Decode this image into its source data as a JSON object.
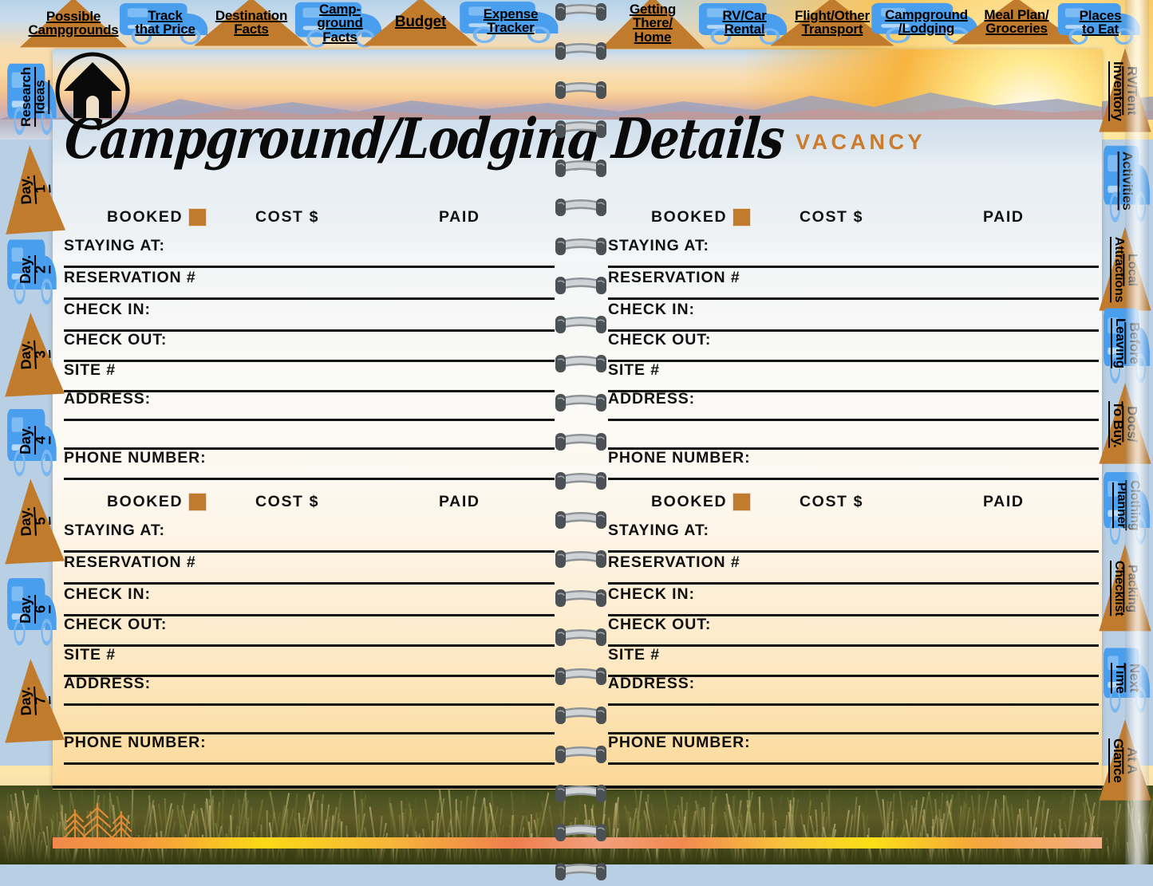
{
  "app": {
    "title": "Campground/Lodging Details",
    "vacancy_label": "VACANCY",
    "home_icon": "home-icon"
  },
  "colors": {
    "tab_orange": "#c07b2d",
    "tab_blue": "#4a9eee",
    "accent_orange": "#cb7b2a",
    "rule_black": "#111111",
    "checkbox_orange": "#c07b2d"
  },
  "top_tabs": [
    {
      "label": "Possible Campgrounds",
      "shape": "tent",
      "lines": [
        "Possible",
        "Campgrounds"
      ]
    },
    {
      "label": "Track that Price",
      "shape": "rv",
      "lines": [
        "Track",
        "that Price"
      ]
    },
    {
      "label": "Destination Facts",
      "shape": "tent",
      "lines": [
        "Destination",
        "Facts"
      ]
    },
    {
      "label": "Campground Facts",
      "shape": "rv",
      "lines": [
        "Camp-",
        "ground",
        "Facts"
      ]
    },
    {
      "label": "Budget",
      "shape": "tent",
      "lines": [
        "Budget"
      ]
    },
    {
      "label": "Expense Tracker",
      "shape": "rv",
      "lines": [
        "Expense",
        "Tracker"
      ]
    },
    {
      "label": "Getting There/ Home",
      "shape": "tent",
      "lines": [
        "Getting",
        "There/",
        "Home"
      ]
    },
    {
      "label": "RV/Car Rental",
      "shape": "rv",
      "lines": [
        "RV/Car",
        "Rental"
      ]
    },
    {
      "label": "Flight/Other Transport",
      "shape": "tent",
      "lines": [
        "Flight/Other",
        "Transport"
      ]
    },
    {
      "label": "Campground /Lodging",
      "shape": "rv",
      "lines": [
        "Campground",
        "/Lodging"
      ]
    },
    {
      "label": "Meal Plan/ Groceries",
      "shape": "tent",
      "lines": [
        "Meal Plan/",
        "Groceries"
      ]
    },
    {
      "label": "Places to Eat",
      "shape": "rv",
      "lines": [
        "Places",
        "to Eat"
      ]
    }
  ],
  "left_tabs": [
    {
      "label": "Research Ideas",
      "shape": "rv",
      "lines": [
        "Research",
        "Ideas"
      ]
    },
    {
      "label": "Day. 1",
      "shape": "tent",
      "lines": [
        "Day.",
        "1"
      ]
    },
    {
      "label": "Day. 2",
      "shape": "rv",
      "lines": [
        "Day.",
        "2"
      ]
    },
    {
      "label": "Day. 3",
      "shape": "tent",
      "lines": [
        "Day.",
        "3"
      ]
    },
    {
      "label": "Day. 4",
      "shape": "rv",
      "lines": [
        "Day.",
        "4"
      ]
    },
    {
      "label": "Day. 5",
      "shape": "tent",
      "lines": [
        "Day.",
        "5"
      ]
    },
    {
      "label": "Day. 6",
      "shape": "rv",
      "lines": [
        "Day.",
        "6"
      ]
    },
    {
      "label": "Day. 7",
      "shape": "tent",
      "lines": [
        "Day.",
        "7"
      ]
    }
  ],
  "right_tabs": [
    {
      "label": "RV/Tent Inventory",
      "shape": "tent",
      "lines": [
        "RV/Tent",
        "Inventory"
      ]
    },
    {
      "label": "Activities",
      "shape": "rv",
      "lines": [
        "Activities"
      ]
    },
    {
      "label": "Local Attractions",
      "shape": "tent",
      "lines": [
        "Local",
        "Attractions"
      ]
    },
    {
      "label": "Before Leaving",
      "shape": "rv",
      "lines": [
        "Before",
        "Leaving"
      ]
    },
    {
      "label": "Docs/ To Buy.",
      "shape": "tent",
      "lines": [
        "Docs/",
        "To Buy."
      ]
    },
    {
      "label": "Clothing Planner",
      "shape": "rv",
      "lines": [
        "Clothing",
        "Planner"
      ]
    },
    {
      "label": "Packing Checklist",
      "shape": "tent",
      "lines": [
        "Packing",
        "Checklist"
      ]
    },
    {
      "label": "Next Time",
      "shape": "rv",
      "lines": [
        "Next",
        "Time"
      ]
    },
    {
      "label": "At A Glance",
      "shape": "tent",
      "lines": [
        "At A",
        "Glance"
      ]
    }
  ],
  "entry_header": {
    "booked": "BOOKED",
    "cost": "COST $",
    "paid": "PAID"
  },
  "entry_fields": [
    "STAYING AT:",
    "RESERVATION #",
    "CHECK IN:",
    "CHECK OUT:",
    "SITE #",
    "ADDRESS:",
    "",
    "PHONE NUMBER:"
  ],
  "entries": [
    {
      "side": "left",
      "index": 1
    },
    {
      "side": "right",
      "index": 2
    },
    {
      "side": "left",
      "index": 3
    },
    {
      "side": "right",
      "index": 4
    }
  ]
}
